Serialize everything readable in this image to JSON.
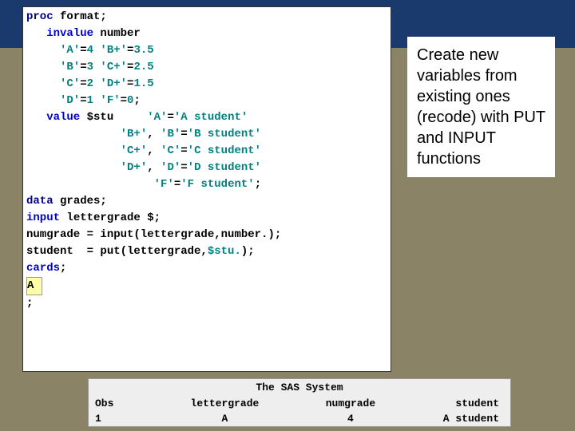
{
  "code": {
    "l1a": "proc",
    "l1b": " format;",
    "l2a": "   invalue",
    "l2b": " number",
    "l3a": "     'A'",
    "l3b": "=",
    "l3c": "4",
    "l3d": " 'B+'",
    "l3e": "=",
    "l3f": "3.5",
    "l4a": "     'B'",
    "l4b": "=",
    "l4c": "3",
    "l4d": " 'C+'",
    "l4e": "=",
    "l4f": "2.5",
    "l5a": "     'C'",
    "l5b": "=",
    "l5c": "2",
    "l5d": " 'D+'",
    "l5e": "=",
    "l5f": "1.5",
    "l6a": "     'D'",
    "l6b": "=",
    "l6c": "1",
    "l6d": " 'F'",
    "l6e": "=",
    "l6f": "0",
    "l6g": ";",
    "l7a": "   value",
    "l7b": " $stu     ",
    "l7c": "'A'",
    "l7d": "=",
    "l7e": "'A student'",
    "l8a": "              ",
    "l8b": "'B+'",
    "l8c": ", ",
    "l8d": "'B'",
    "l8e": "=",
    "l8f": "'B student'",
    "l9a": "              ",
    "l9b": "'C+'",
    "l9c": ", ",
    "l9d": "'C'",
    "l9e": "=",
    "l9f": "'C student'",
    "l10a": "              ",
    "l10b": "'D+'",
    "l10c": ", ",
    "l10d": "'D'",
    "l10e": "=",
    "l10f": "'D student'",
    "l11a": "                   ",
    "l11b": "'F'",
    "l11c": "=",
    "l11d": "'F student'",
    "l11e": ";",
    "l12a": "data",
    "l12b": " grades;",
    "l13a": "input",
    "l13b": " lettergrade $;",
    "l14": "numgrade = input(lettergrade,",
    "l14b": "number.",
    "l14c": ");",
    "l15": "student  = put(lettergrade,",
    "l15b": "$stu.",
    "l15c": ");",
    "l16": "cards",
    "l16b": ";",
    "l17": "A",
    "l18": ";"
  },
  "caption": "Create new variables from existing ones (recode) with PUT and INPUT functions",
  "output": {
    "title": "The SAS System",
    "headers": {
      "obs": "Obs",
      "lg": "lettergrade",
      "ng": "numgrade",
      "st": "student"
    },
    "row": {
      "obs": "1",
      "lg": "A",
      "ng": "4",
      "st": "A student"
    }
  }
}
